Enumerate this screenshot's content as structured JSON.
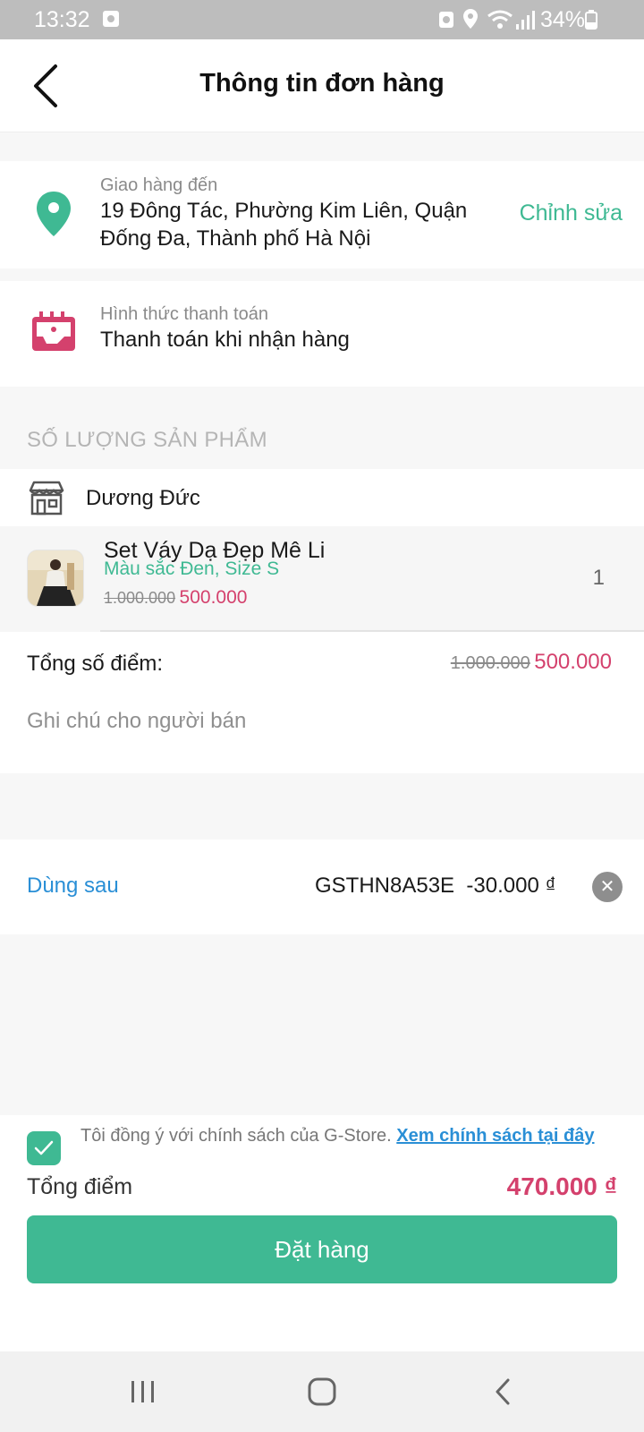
{
  "status_bar": {
    "time": "13:32",
    "battery": "34%"
  },
  "header": {
    "title": "Thông tin đơn hàng"
  },
  "address": {
    "label": "Giao hàng đến",
    "line1": "19 Đông Tác, Phường Kim Liên, Quận",
    "line2": "Đống Đa, Thành phố Hà Nội",
    "edit_label": "Chỉnh sửa"
  },
  "payment": {
    "label": "Hình thức thanh toán",
    "method": "Thanh toán khi nhận hàng"
  },
  "products_section": {
    "title": "SỐ LƯỢNG SẢN PHẨM"
  },
  "shop": {
    "name": "Dương Đức"
  },
  "product": {
    "name": "Set Váy Dạ Đẹp Mê Li",
    "variant": "Màu sắc Đen, Size S",
    "old_price": "1.000.000",
    "price": "500.000",
    "quantity": "1"
  },
  "totals": {
    "label": "Tổng số điểm:",
    "old_value": "1.000.000",
    "value": "500.000",
    "note_placeholder": "Ghi chú cho người bán"
  },
  "coupon": {
    "use_later": "Dùng sau",
    "code": "GSTHN8A53E",
    "discount": "-30.000 ₫"
  },
  "footer": {
    "agree_text": "Tôi đồng ý với chính sách của G-Store.",
    "policy_link": "Xem chính sách tại đây",
    "total_label": "Tổng điểm",
    "total_value": "470.000 ₫",
    "order_button": "Đặt hàng"
  },
  "colors": {
    "accent": "#3fb993",
    "price": "#d4416d",
    "link": "#2a8fd6"
  }
}
